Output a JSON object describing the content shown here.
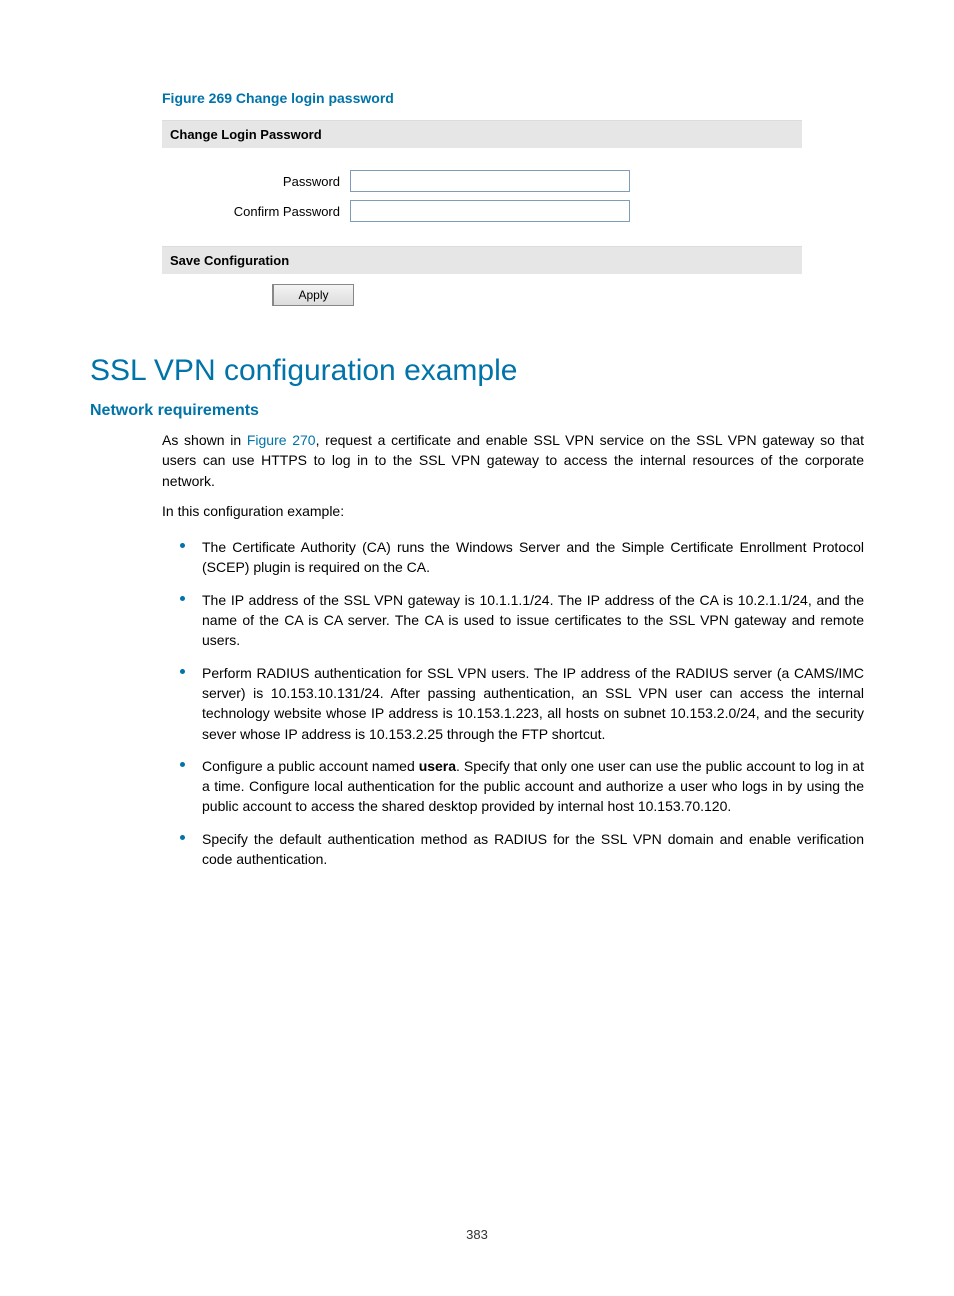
{
  "figure_caption": "Figure 269 Change login password",
  "form": {
    "section1_title": "Change Login Password",
    "password_label": "Password",
    "confirm_label": "Confirm Password",
    "section2_title": "Save Configuration",
    "apply_label": "Apply"
  },
  "main_title": "SSL VPN configuration example",
  "sub_title": "Network requirements",
  "intro": {
    "pre": "As shown in ",
    "link": "Figure 270",
    "post": ", request a certificate and enable SSL VPN service on the SSL VPN gateway so that users can use HTTPS to log in to the SSL VPN gateway to access the internal resources of the corporate network."
  },
  "intro2": "In this configuration example:",
  "bullets": {
    "b1": "The Certificate Authority (CA) runs the Windows Server and the Simple Certificate Enrollment Protocol (SCEP) plugin is required on the CA.",
    "b2": "The IP address of the SSL VPN gateway is 10.1.1.1/24. The IP address of the CA is 10.2.1.1/24, and the name of the CA is CA server. The CA is used to issue certificates to the SSL VPN gateway and remote users.",
    "b3": "Perform RADIUS authentication for SSL VPN users. The IP address of the RADIUS server (a CAMS/IMC server) is 10.153.10.131/24. After passing authentication, an SSL VPN user can access the internal technology website whose IP address is 10.153.1.223, all hosts on subnet 10.153.2.0/24, and the security sever whose IP address is 10.153.2.25 through the FTP shortcut.",
    "b4_pre": "Configure a public account named ",
    "b4_bold": "usera",
    "b4_post": ". Specify that only one user can use the public account to log in at a time. Configure local authentication for the public account and authorize a user who logs in by using the public account to access the shared desktop provided by internal host 10.153.70.120.",
    "b5": "Specify the default authentication method as RADIUS for the SSL VPN domain and enable verification code authentication."
  },
  "page_number": "383"
}
